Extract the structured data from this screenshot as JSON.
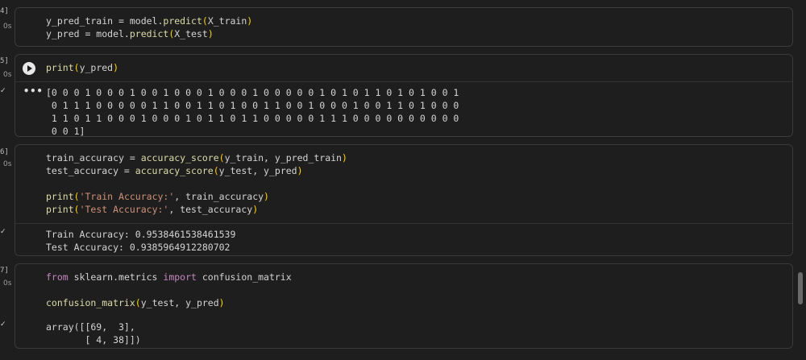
{
  "cells": [
    {
      "exec_num": "4]",
      "time": "0s",
      "code": [
        "y_pred_train = model.predict(X_train)",
        "y_pred = model.predict(X_test)"
      ]
    },
    {
      "exec_num": "5]",
      "time": "0s",
      "code": [
        "print(y_pred)"
      ],
      "output": [
        "[0 0 0 1 0 0 0 1 0 0 1 0 0 0 1 0 0 0 1 0 0 0 0 0 1 0 1 0 1 1 0 1 0 1 0 0 1",
        " 0 1 1 1 0 0 0 0 0 1 1 0 0 1 1 0 1 0 0 1 1 0 0 1 0 0 0 1 0 0 1 1 0 1 0 0 0",
        " 1 1 0 1 1 0 0 0 1 0 0 0 1 0 1 1 0 1 1 0 0 0 0 0 1 1 1 0 0 0 0 0 0 0 0 0 0",
        " 0 0 1]"
      ]
    },
    {
      "exec_num": "6]",
      "time": "0s",
      "code": [
        "train_accuracy = accuracy_score(y_train, y_pred_train)",
        "test_accuracy = accuracy_score(y_test, y_pred)",
        "",
        "print('Train Accuracy:', train_accuracy)",
        "print('Test Accuracy:', test_accuracy)"
      ],
      "output": [
        "Train Accuracy: 0.9538461538461539",
        "Test Accuracy: 0.9385964912280702"
      ]
    },
    {
      "exec_num": "7]",
      "time": "0s",
      "code": [
        "from sklearn.metrics import confusion_matrix",
        "",
        "confusion_matrix(y_test, y_pred)"
      ],
      "output": [
        "array([[69,  3],",
        "       [ 4, 38]])"
      ]
    }
  ],
  "check_icon": "✓",
  "more_icon": "•••"
}
